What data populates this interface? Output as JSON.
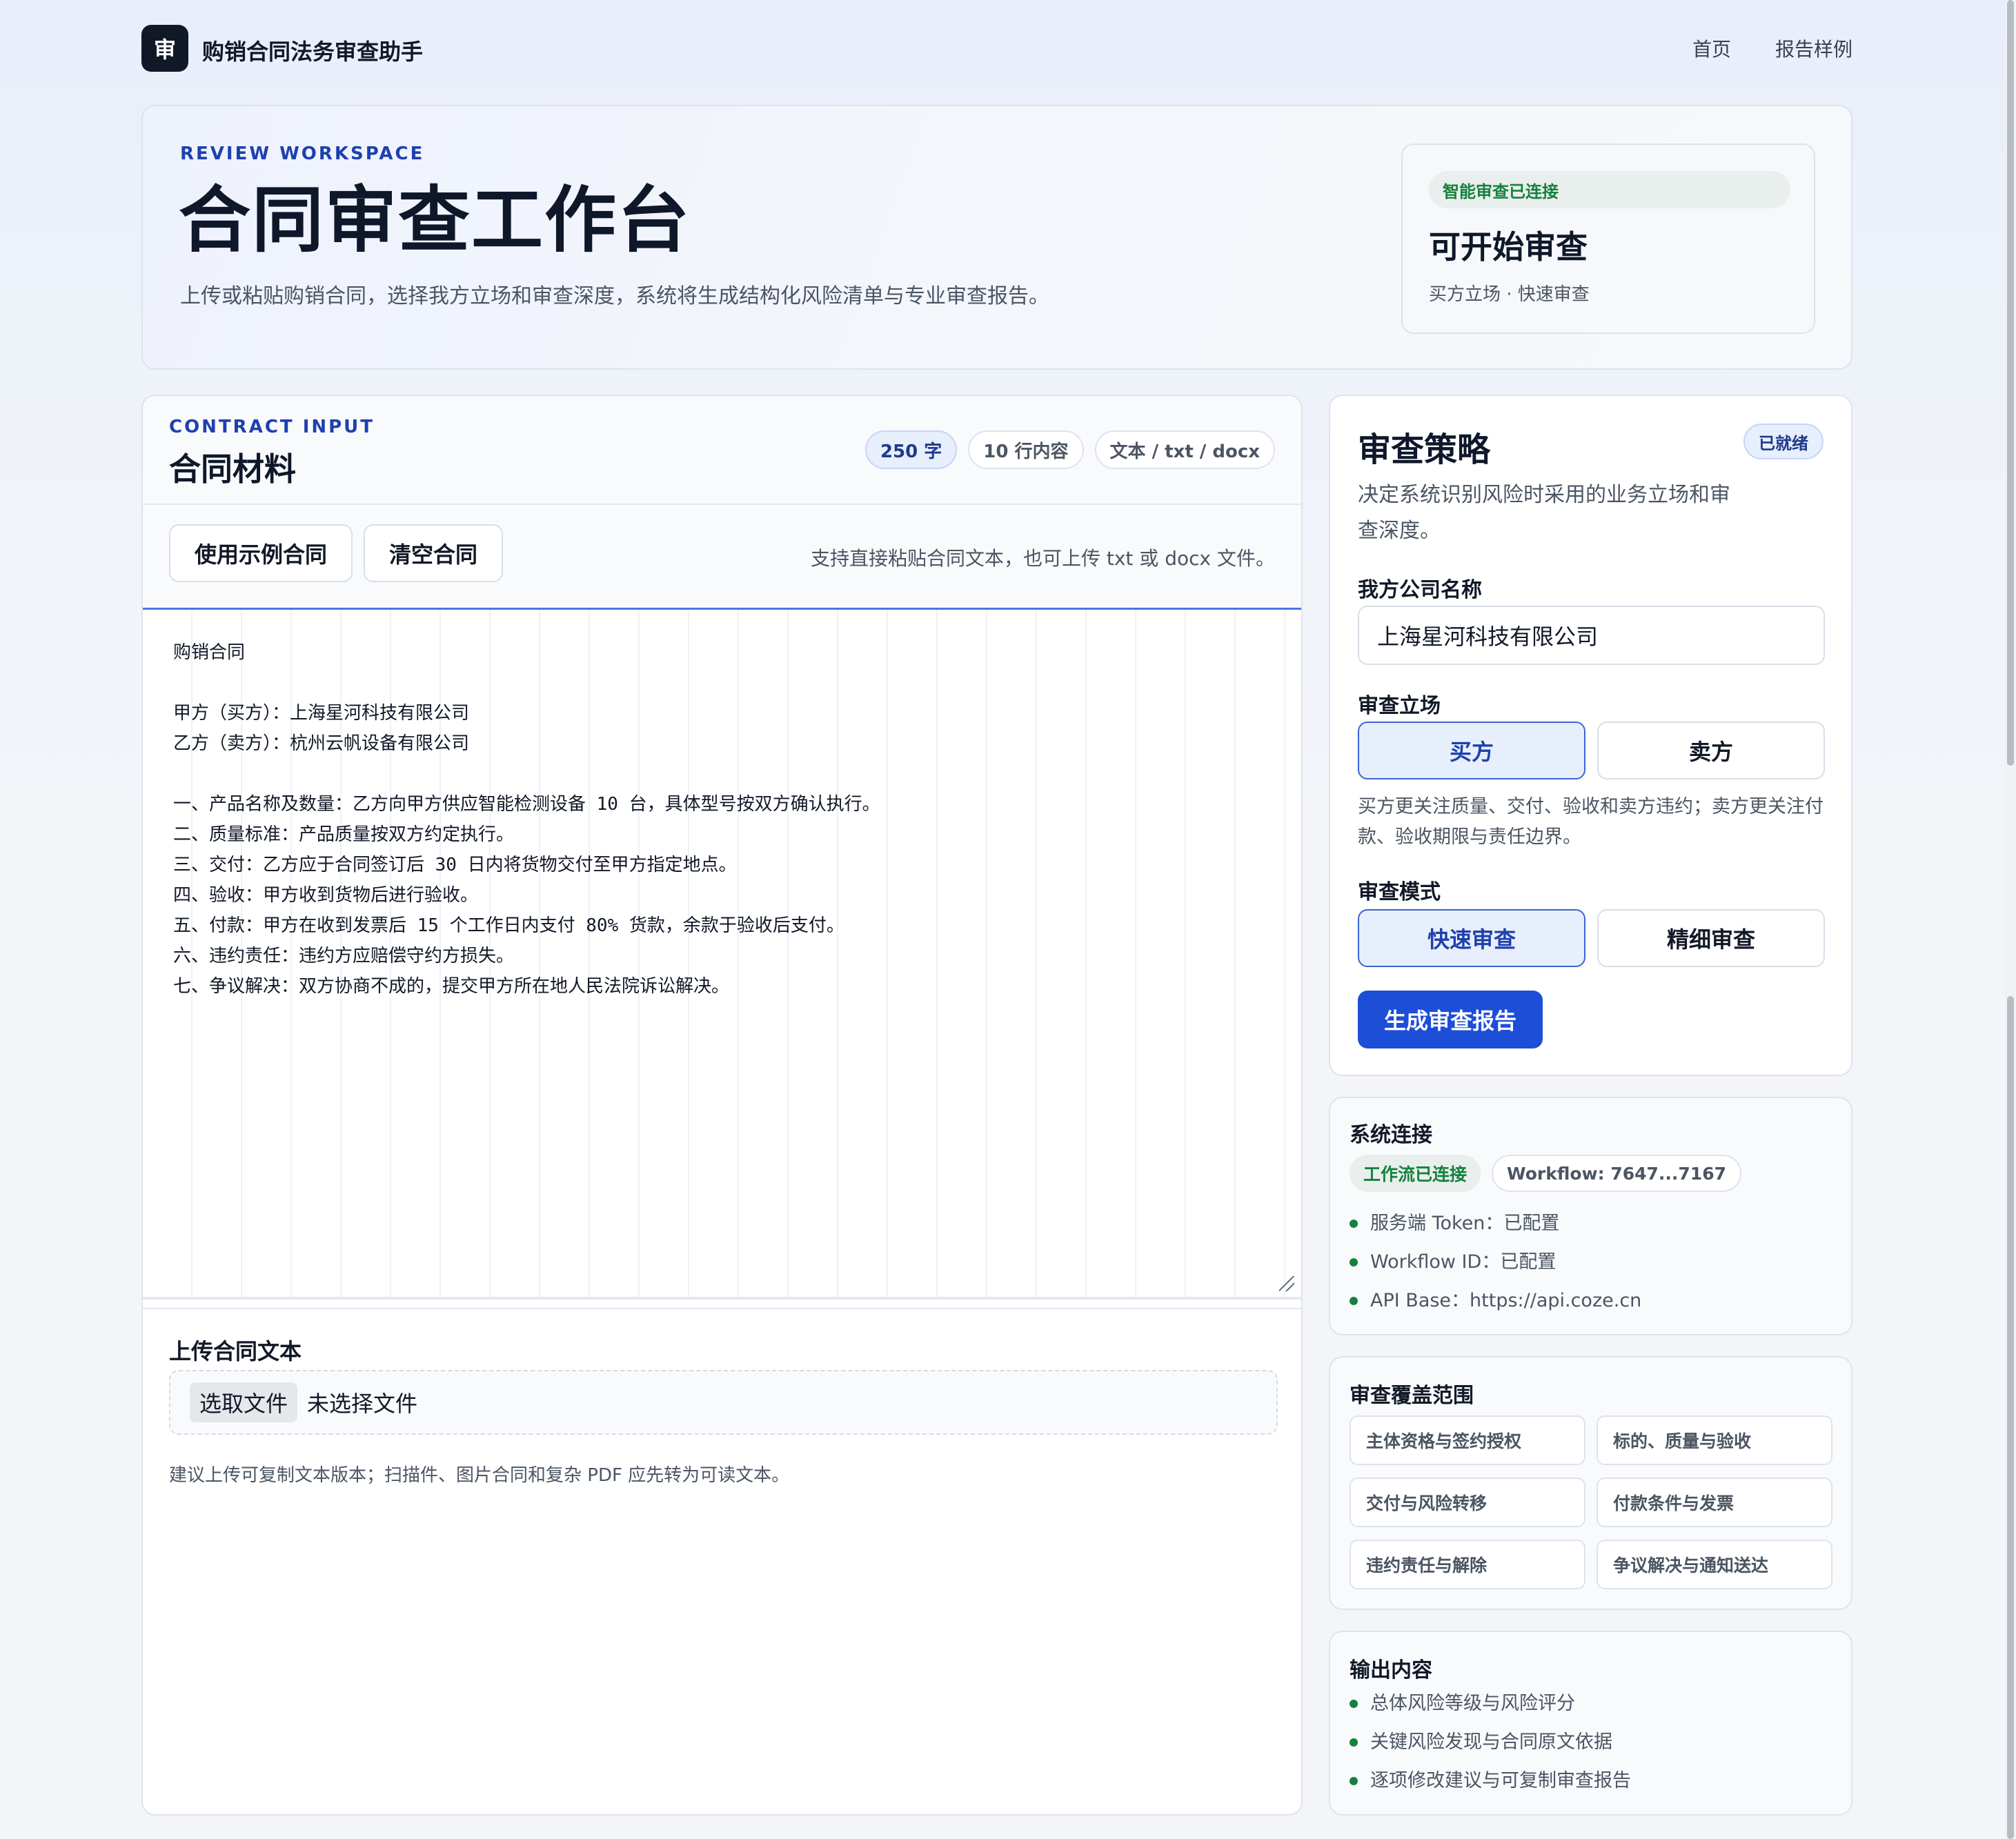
{
  "header": {
    "logo_char": "审",
    "app_title": "购销合同法务审查助手",
    "nav": [
      "首页",
      "报告样例"
    ]
  },
  "hero": {
    "eyebrow": "REVIEW WORKSPACE",
    "title": "合同审查工作台",
    "subtitle": "上传或粘贴购销合同，选择我方立场和审查深度，系统将生成结构化风险清单与专业审查报告。",
    "status_pill": "智能审查已连接",
    "status_title": "可开始审查",
    "status_sub": "买方立场 · 快速审查"
  },
  "input": {
    "eyebrow": "CONTRACT INPUT",
    "title": "合同材料",
    "chips": [
      "250 字",
      "10 行内容",
      "文本 / txt / docx"
    ],
    "btn_example": "使用示例合同",
    "btn_clear": "清空合同",
    "hint": "支持直接粘贴合同文本，也可上传 txt 或 docx 文件。",
    "contract_text": "购销合同\n\n甲方（买方）：上海星河科技有限公司\n乙方（卖方）：杭州云帆设备有限公司\n\n一、产品名称及数量：乙方向甲方供应智能检测设备 10 台，具体型号按双方确认执行。\n二、质量标准：产品质量按双方约定执行。\n三、交付：乙方应于合同签订后 30 日内将货物交付至甲方指定地点。\n四、验收：甲方收到货物后进行验收。\n五、付款：甲方在收到发票后 15 个工作日内支付 80% 货款，余款于验收后支付。\n六、违约责任：违约方应赔偿守约方损失。\n七、争议解决：双方协商不成的，提交甲方所在地人民法院诉讼解决。",
    "upload_label": "上传合同文本",
    "file_button": "选取文件",
    "file_none": "未选择文件",
    "upload_hint": "建议上传可复制文本版本；扫描件、图片合同和复杂 PDF 应先转为可读文本。"
  },
  "strategy": {
    "title": "审查策略",
    "badge": "已就绪",
    "desc": "决定系统识别风险时采用的业务立场和审查深度。",
    "company_label": "我方公司名称",
    "company_value": "上海星河科技有限公司",
    "position_label": "审查立场",
    "position_options": [
      "买方",
      "卖方"
    ],
    "position_selected": "买方",
    "position_hint": "买方更关注质量、交付、验收和卖方违约；卖方更关注付款、验收期限与责任边界。",
    "mode_label": "审查模式",
    "mode_options": [
      "快速审查",
      "精细审查"
    ],
    "mode_selected": "快速审查",
    "generate": "生成审查报告"
  },
  "system": {
    "title": "系统连接",
    "chip_connected": "工作流已连接",
    "chip_workflow": "Workflow: 7647...7167",
    "items": [
      "服务端 Token：已配置",
      "Workflow ID：已配置",
      "API Base：https://api.coze.cn"
    ],
    "accent": "#15803d"
  },
  "coverage": {
    "title": "审查覆盖范围",
    "items": [
      "主体资格与签约授权",
      "标的、质量与验收",
      "交付与风险转移",
      "付款条件与发票",
      "违约责任与解除",
      "争议解决与通知送达"
    ]
  },
  "output": {
    "title": "输出内容",
    "items": [
      "总体风险等级与风险评分",
      "关键风险发现与合同原文依据",
      "逐项修改建议与可复制审查报告"
    ]
  },
  "colors": {
    "primary": "#1d4ed8",
    "dark": "#111827",
    "success": "#15803d"
  }
}
